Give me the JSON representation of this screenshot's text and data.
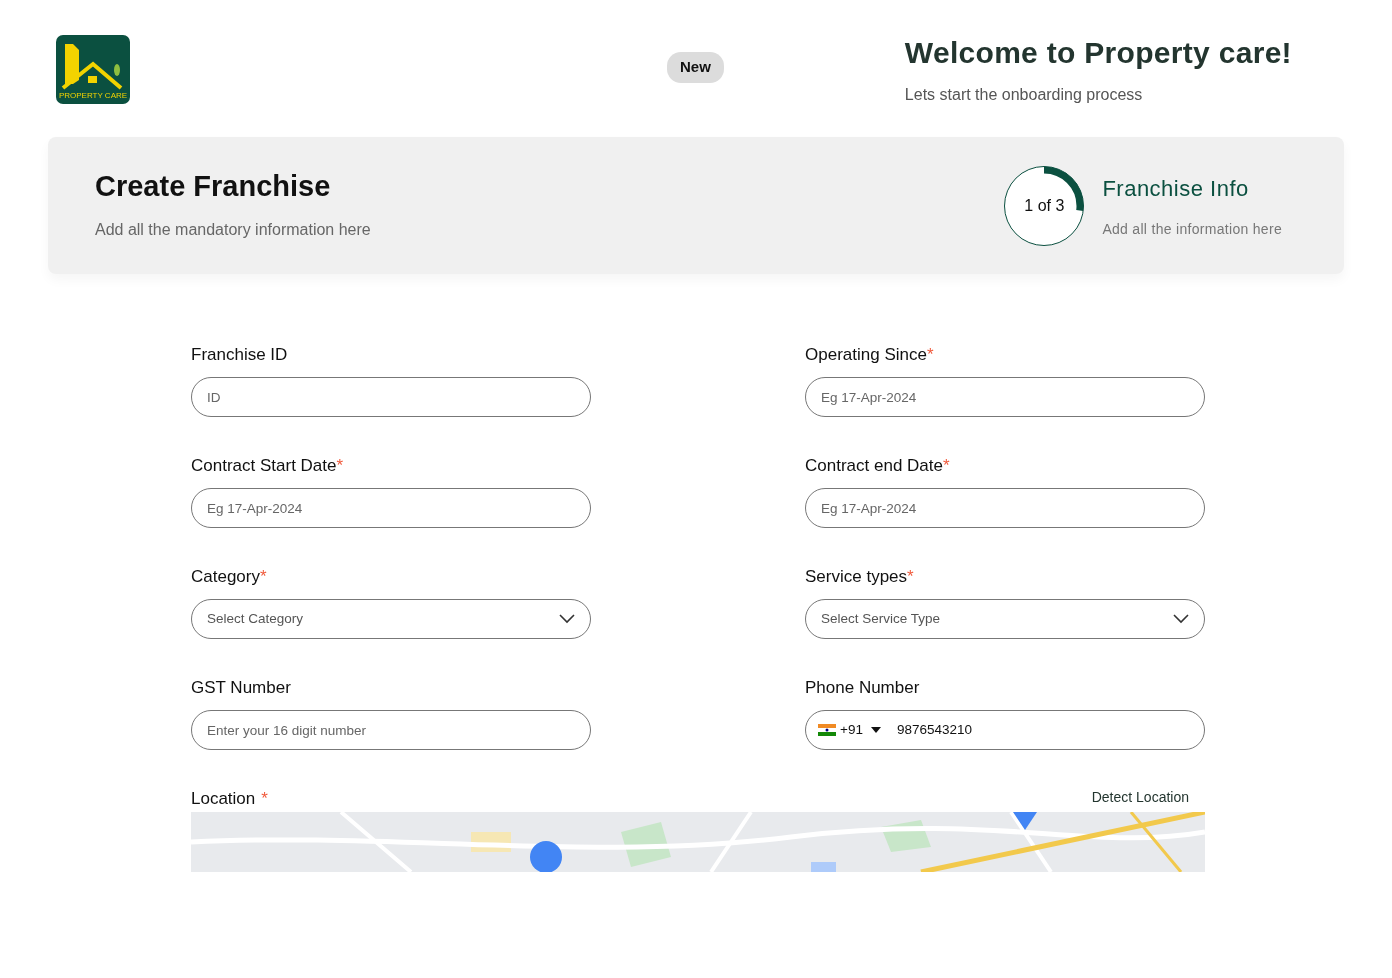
{
  "header": {
    "logo_text": "PROPERTY CARE",
    "badge": "New",
    "title": "Welcome to Property care!",
    "subtitle": "Lets start the onboarding process"
  },
  "banner": {
    "title": "Create Franchise",
    "subtitle": "Add all the mandatory information here",
    "step": {
      "label": "1 of 3",
      "level": 0.27,
      "title": "Franchise Info",
      "subtitle": "Add all the information here"
    }
  },
  "fields": [
    {
      "kind": "text",
      "label": "Franchise ID",
      "placeholder": "ID"
    },
    {
      "kind": "text",
      "label": "Operating Since",
      "required_mark": "*",
      "placeholder": "Eg 17-Apr-2024"
    },
    {
      "kind": "text",
      "label": "Contract Start Date",
      "required_mark": "*",
      "placeholder": "Eg 17-Apr-2024"
    },
    {
      "kind": "text",
      "label": "Contract end Date",
      "required_mark": "*",
      "placeholder": "Eg 17-Apr-2024"
    },
    {
      "kind": "select",
      "label": "Category",
      "required_mark": "*",
      "placeholder": "Select Category"
    },
    {
      "kind": "select",
      "label": "Service types",
      "required_mark": "*",
      "placeholder": "Select Service Type"
    },
    {
      "kind": "text",
      "label": "GST  Number",
      "placeholder": "Enter your 16 digit number"
    },
    {
      "kind": "phone",
      "label": "Phone Number",
      "code": "+91",
      "value": "9876543210"
    }
  ],
  "location": {
    "label": "Location",
    "required_mark": "*",
    "action": "Detect Location"
  }
}
